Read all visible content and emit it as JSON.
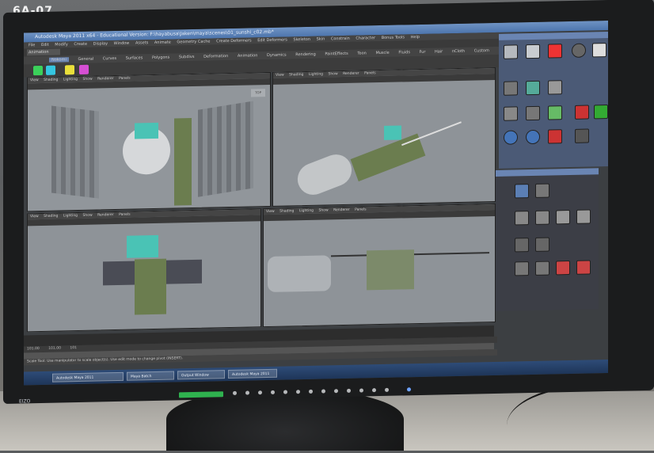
{
  "photo": {
    "sticker_label": "6A-07",
    "monitor_brand": "EIZO"
  },
  "maya": {
    "title": "Autodesk Maya 2011 x64 - Educational Version: F:\\hayabusa\\Jaken\\maya\\scenes\\01_sunshi_c02.mb*",
    "menus": [
      "File",
      "Edit",
      "Modify",
      "Create",
      "Display",
      "Window",
      "Assets",
      "Animate",
      "Geometry Cache",
      "Create Deformers",
      "Edit Deformers",
      "Skeleton",
      "Skin",
      "Constrain",
      "Character",
      "Bonus Tools",
      "Help"
    ],
    "mode_select": "Animation",
    "shelf_tabs": [
      "Nokomi",
      "General",
      "Curves",
      "Surfaces",
      "Polygons",
      "Subdivs",
      "Deformation",
      "Animation",
      "Dynamics",
      "Rendering",
      "PaintEffects",
      "Toon",
      "Muscle",
      "Fluids",
      "Fur",
      "Hair",
      "nCloth",
      "Custom"
    ],
    "viewport_menu": [
      "View",
      "Shading",
      "Lighting",
      "Show",
      "Renderer",
      "Panels"
    ],
    "viewport_label": "TOP",
    "range_start": "101.00",
    "range_end": "101.00",
    "range_current": "101",
    "mel_label": "MEL",
    "help_text": "Scale Tool: Use manipulator to scale object(s). Use edit mode to change pivot (INSERT)."
  },
  "taskbar": {
    "items": [
      "Autodesk Maya 2011",
      "Maya Batch",
      "Output Window",
      "Autodesk Maya 2011"
    ]
  },
  "colors": {
    "screen_bg": "#3c3f42",
    "viewport_bg": "#8e9398",
    "accent": "#6a85b3",
    "power_led": "#2fb24f"
  }
}
